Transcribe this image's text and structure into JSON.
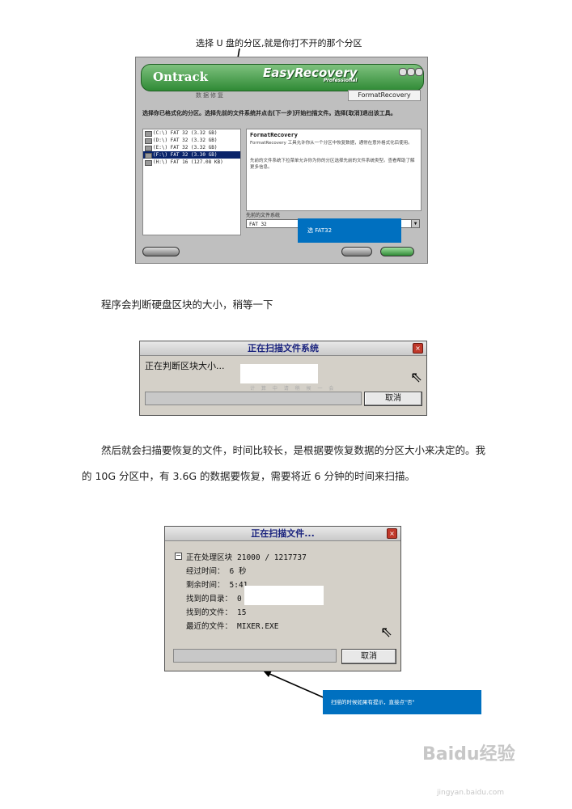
{
  "top_caption": "选择 U 盘的分区,就是你打不开的那个分区",
  "easyrecovery": {
    "brand": "Ontrack",
    "product": "EasyRecovery",
    "edition": "Professional",
    "nav_tabs": "数据修复",
    "mode_tab": "FormatRecovery",
    "instruction": "选择你已格式化的分区。选择先前的文件系统并点击[下一步]开始扫描文件。选择[取消]退出该工具。",
    "partitions": [
      "(C:\\) FAT 32 (3.32 GB)",
      "(D:\\) FAT 32 (3.32 GB)",
      "(E:\\) FAT 32 (3.32 GB)",
      "(F:\\) FAT 32 (3.30 GB)",
      "(H:\\) FAT 16 (127.08 KB)"
    ],
    "desc_title": "FormatRecovery",
    "desc_text_1": "FormatRecovery 工具允许你从一个分区中恢复数据，通常在意外格式化后使用。",
    "desc_text_2": "先前的文件系统下拉菜单允许你为你的分区选择先前的文件系统类型。查看帮助了解更多信息。",
    "fs_label": "先前的文件系统",
    "fs_value": "FAT 32",
    "callout": "选 FAT32"
  },
  "para1": "程序会判断硬盘区块的大小，稍等一下",
  "dialog_scan_fs": {
    "title": "正在扫描文件系统",
    "message": "正在判断区块大小...",
    "faint": "计 算 中  请 稍 候 一 会",
    "cancel": "取消"
  },
  "para2_line1": "然后就会扫描要恢复的文件，时间比较长，是根据要恢复数据的分区大小来决定的。我",
  "para2_line2": "的 10G 分区中，有 3.6G 的数据要恢复，需要将近 6 分钟的时间来扫描。",
  "dialog_scan_files": {
    "title": "正在扫描文件...",
    "rows": [
      {
        "label": "正在处理区块",
        "value": "21000 / 1217737"
      },
      {
        "label": "经过时间：",
        "value": "6 秒"
      },
      {
        "label": "剩余时间：",
        "value": "5:41"
      },
      {
        "label": "找到的目录：",
        "value": "0"
      },
      {
        "label": "找到的文件：",
        "value": "15"
      },
      {
        "label": "最近的文件：",
        "value": "MIXER.EXE"
      }
    ],
    "cancel": "取消"
  },
  "callout2": "扫描的时候如果有提示，直接点\"否\"",
  "watermark": "Baidu经验",
  "watermark_url": "jingyan.baidu.com"
}
